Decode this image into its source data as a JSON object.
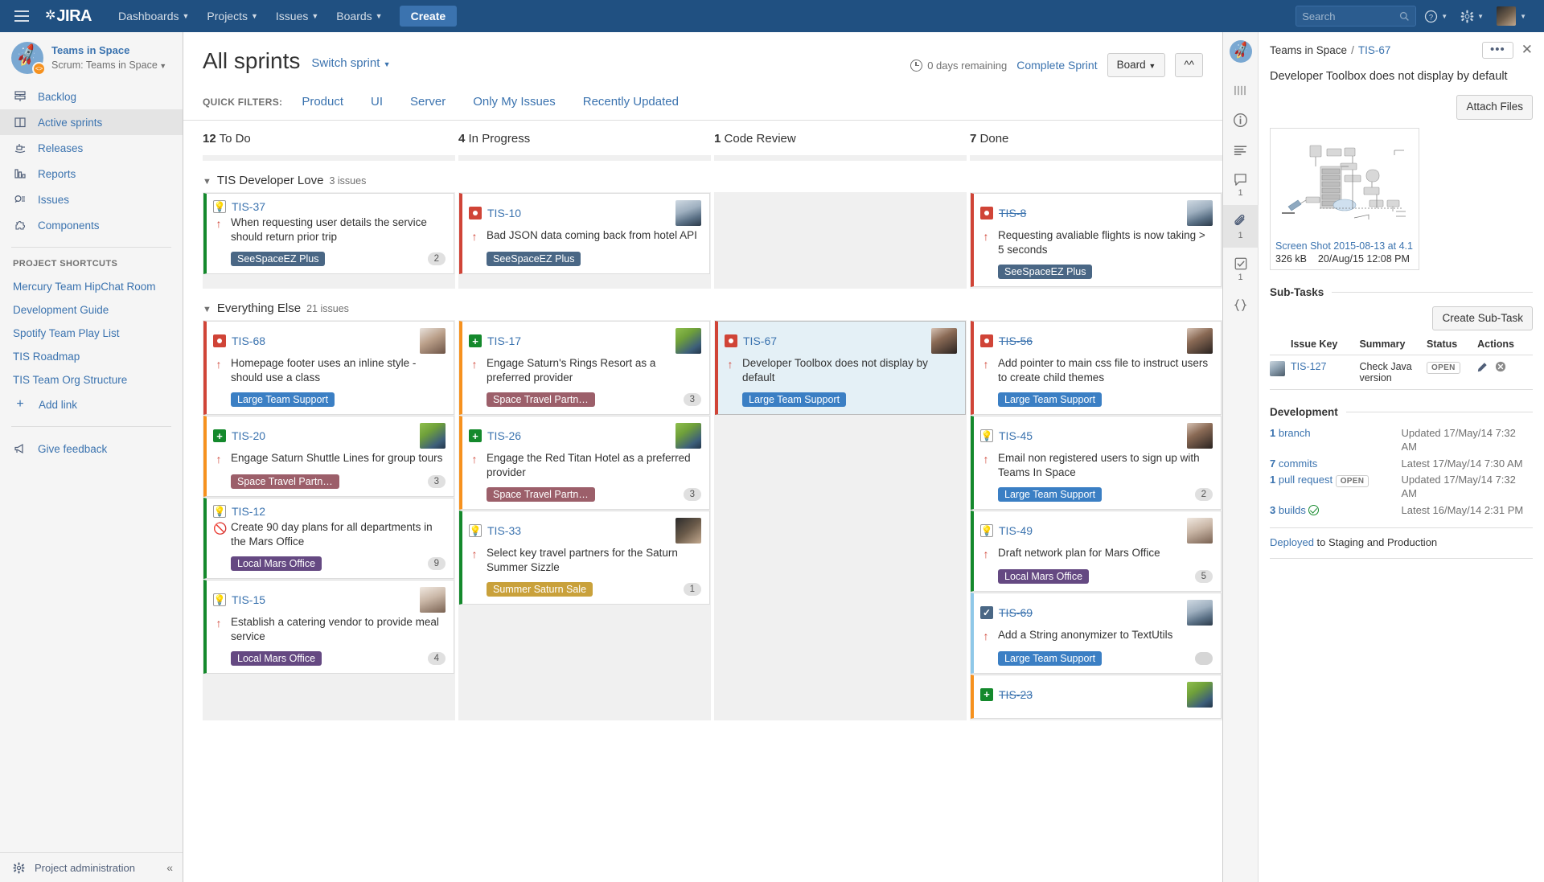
{
  "topnav": {
    "logo_text": "JIRA",
    "menus": [
      {
        "label": "Dashboards"
      },
      {
        "label": "Projects"
      },
      {
        "label": "Issues"
      },
      {
        "label": "Boards"
      }
    ],
    "create_label": "Create",
    "search_placeholder": "Search",
    "help_icon": "question-circle-icon",
    "settings_icon": "gear-icon",
    "profile_icon": "user-avatar"
  },
  "sidebar": {
    "project_name": "Teams in Space",
    "project_type": "Scrum: Teams in Space",
    "items": [
      {
        "label": "Backlog",
        "icon": "backlog-icon",
        "active": false
      },
      {
        "label": "Active sprints",
        "icon": "board-columns-icon",
        "active": true
      },
      {
        "label": "Releases",
        "icon": "releases-icon",
        "active": false
      },
      {
        "label": "Reports",
        "icon": "reports-bar-icon",
        "active": false
      },
      {
        "label": "Issues",
        "icon": "issues-search-icon",
        "active": false
      },
      {
        "label": "Components",
        "icon": "components-puzzle-icon",
        "active": false
      }
    ],
    "shortcuts_title": "PROJECT SHORTCUTS",
    "shortcuts": [
      {
        "label": "Mercury Team HipChat Room"
      },
      {
        "label": "Development Guide"
      },
      {
        "label": "Spotify Team Play List"
      },
      {
        "label": "TIS Roadmap"
      },
      {
        "label": "TIS Team Org Structure"
      }
    ],
    "add_link_label": "Add link",
    "feedback_label": "Give feedback",
    "admin_label": "Project administration",
    "collapse_icon": "chevron-double-left-icon"
  },
  "board": {
    "title": "All sprints",
    "switch_sprint": "Switch sprint",
    "days_remaining": "0 days remaining",
    "complete_sprint": "Complete Sprint",
    "board_button": "Board",
    "collapse_button_icon": "chevron-double-up-icon",
    "quick_filters_label": "QUICK FILTERS:",
    "quick_filters": [
      {
        "label": "Product"
      },
      {
        "label": "UI"
      },
      {
        "label": "Server"
      },
      {
        "label": "Only My Issues"
      },
      {
        "label": "Recently Updated"
      }
    ],
    "columns": [
      {
        "count": "12",
        "name": "To Do"
      },
      {
        "count": "4",
        "name": "In Progress"
      },
      {
        "count": "1",
        "name": "Code Review"
      },
      {
        "count": "7",
        "name": "Done"
      }
    ],
    "swimlanes": [
      {
        "name": "TIS Developer Love",
        "count": "3 issues",
        "columns": [
          [
            {
              "key": "TIS-37",
              "type": "story",
              "type_icon": "story-lightbulb-icon",
              "summary": "When requesting user details the service should return prior trip",
              "priority_icon": "priority-up-icon",
              "epic": "SeeSpaceEZ Plus",
              "epic_color": "e-blue-dark",
              "points": "2",
              "avatar": null,
              "border": "#14892c",
              "done": false
            }
          ],
          [
            {
              "key": "TIS-10",
              "type": "bug",
              "type_icon": "bug-icon",
              "summary": "Bad JSON data coming back from hotel API",
              "priority_icon": "priority-up-icon",
              "epic": "SeeSpaceEZ Plus",
              "epic_color": "e-blue-dark",
              "points": null,
              "avatar": "f1",
              "border": "#d04437",
              "done": false
            }
          ],
          [],
          [
            {
              "key": "TIS-8",
              "type": "bug",
              "type_icon": "bug-icon",
              "summary": "Requesting avaliable flights is now taking > 5 seconds",
              "priority_icon": "priority-up-icon",
              "epic": "SeeSpaceEZ Plus",
              "epic_color": "e-blue-dark",
              "points": null,
              "avatar": "f1",
              "border": "#d04437",
              "done": true
            }
          ]
        ]
      },
      {
        "name": "Everything Else",
        "count": "21 issues",
        "columns": [
          [
            {
              "key": "TIS-68",
              "type": "bug",
              "type_icon": "bug-icon",
              "summary": "Homepage footer uses an inline style - should use a class",
              "priority_icon": "priority-up-icon",
              "epic": "Large Team Support",
              "epic_color": "e-blue",
              "points": null,
              "avatar": "f2",
              "border": "#d04437",
              "done": false
            },
            {
              "key": "TIS-20",
              "type": "feature",
              "type_icon": "new-feature-plus-icon",
              "summary": "Engage Saturn Shuttle Lines for group tours",
              "priority_icon": "priority-up-icon",
              "epic": "Space Travel Partn…",
              "epic_color": "e-mauve",
              "points": "3",
              "avatar": "f3",
              "border": "#f6911e",
              "done": false
            },
            {
              "key": "TIS-12",
              "type": "story",
              "type_icon": "story-lightbulb-icon",
              "summary": "Create 90 day plans for all departments in the Mars Office",
              "priority_icon": "blocker-icon",
              "epic": "Local Mars Office",
              "epic_color": "e-purple",
              "points": "9",
              "avatar": null,
              "border": "#14892c",
              "done": false
            },
            {
              "key": "TIS-15",
              "type": "story",
              "type_icon": "story-lightbulb-icon",
              "summary": "Establish a catering vendor to provide meal service",
              "priority_icon": "priority-up-icon",
              "epic": "Local Mars Office",
              "epic_color": "e-purple",
              "points": "4",
              "avatar": "f5",
              "border": "#14892c",
              "done": false
            }
          ],
          [
            {
              "key": "TIS-17",
              "type": "feature",
              "type_icon": "new-feature-plus-icon",
              "summary": "Engage Saturn's Rings Resort as a preferred provider",
              "priority_icon": "priority-up-icon",
              "epic": "Space Travel Partn…",
              "epic_color": "e-mauve",
              "points": "3",
              "avatar": "f3",
              "border": "#f6911e",
              "done": false
            },
            {
              "key": "TIS-26",
              "type": "feature",
              "type_icon": "new-feature-plus-icon",
              "summary": "Engage the Red Titan Hotel as a preferred provider",
              "priority_icon": "priority-up-icon",
              "epic": "Space Travel Partn…",
              "epic_color": "e-mauve",
              "points": "3",
              "avatar": "f3",
              "border": "#f6911e",
              "done": false
            },
            {
              "key": "TIS-33",
              "type": "story",
              "type_icon": "story-lightbulb-icon",
              "summary": "Select key travel partners for the Saturn Summer Sizzle",
              "priority_icon": "priority-up-icon",
              "epic": "Summer Saturn Sale",
              "epic_color": "e-gold",
              "points": "1",
              "avatar": "f6",
              "border": "#14892c",
              "done": false
            }
          ],
          [
            {
              "key": "TIS-67",
              "type": "bug",
              "type_icon": "bug-icon",
              "summary": "Developer Toolbox does not display by default",
              "priority_icon": "priority-up-icon",
              "epic": "Large Team Support",
              "epic_color": "e-blue",
              "points": null,
              "avatar": "f4",
              "border": "#d04437",
              "done": false,
              "selected": true
            }
          ],
          [
            {
              "key": "TIS-56",
              "type": "bug",
              "type_icon": "bug-icon",
              "summary": "Add pointer to main css file to instruct users to create child themes",
              "priority_icon": "priority-up-icon",
              "epic": "Large Team Support",
              "epic_color": "e-blue",
              "points": null,
              "avatar": "f4",
              "border": "#d04437",
              "done": true
            },
            {
              "key": "TIS-45",
              "type": "story",
              "type_icon": "story-lightbulb-icon",
              "summary": "Email non registered users to sign up with Teams In Space",
              "priority_icon": "priority-up-icon",
              "epic": "Large Team Support",
              "epic_color": "e-blue",
              "points": "2",
              "avatar": "f4",
              "border": "#14892c",
              "done": false
            },
            {
              "key": "TIS-49",
              "type": "story",
              "type_icon": "story-lightbulb-icon",
              "summary": "Draft network plan for Mars Office",
              "priority_icon": "priority-up-icon",
              "epic": "Local Mars Office",
              "epic_color": "e-purple",
              "points": "5",
              "avatar": "f5",
              "border": "#14892c",
              "done": false
            },
            {
              "key": "TIS-69",
              "type": "task",
              "type_icon": "task-check-icon",
              "summary": "Add a String anonymizer to TextUtils",
              "priority_icon": "priority-up-icon",
              "epic": "Large Team Support",
              "epic_color": "e-blue",
              "points": "",
              "avatar": "f1",
              "border": "#8fc8e8",
              "done": true
            },
            {
              "key": "TIS-23",
              "type": "feature",
              "type_icon": "new-feature-plus-icon",
              "summary": "",
              "priority_icon": "",
              "epic": "",
              "epic_color": "e-mauve",
              "points": null,
              "avatar": "f3",
              "border": "#f6911e",
              "done": true
            }
          ]
        ]
      }
    ]
  },
  "detail": {
    "rail": [
      {
        "icon": "columns-bars-icon",
        "badge": null,
        "selected": false
      },
      {
        "icon": "info-circle-icon",
        "badge": null,
        "selected": false
      },
      {
        "icon": "description-lines-icon",
        "badge": null,
        "selected": false
      },
      {
        "icon": "comment-bubble-icon",
        "badge": "1",
        "selected": false
      },
      {
        "icon": "paperclip-icon",
        "badge": "1",
        "selected": true
      },
      {
        "icon": "subtask-check-icon",
        "badge": "1",
        "selected": false
      },
      {
        "icon": "code-braces-icon",
        "badge": null,
        "selected": false
      }
    ],
    "breadcrumb_project": "Teams in Space",
    "breadcrumb_sep": "/",
    "breadcrumb_key": "TIS-67",
    "more_actions": "•••",
    "close_icon": "close-x-icon",
    "summary": "Developer Toolbox does not display by default",
    "attach_files_label": "Attach Files",
    "attachment": {
      "name": "Screen Shot 2015-08-13 at 4.1",
      "size": "326 kB",
      "date": "20/Aug/15 12:08 PM"
    },
    "subtasks_title": "Sub-Tasks",
    "create_subtask_label": "Create Sub-Task",
    "subtasks_headers": [
      "Issue Key",
      "Summary",
      "Status",
      "Actions"
    ],
    "subtasks_rows": [
      {
        "avatar": "f7",
        "key": "TIS-127",
        "summary": "Check Java version",
        "status": "OPEN",
        "edit_icon": "pencil-icon",
        "delete_icon": "delete-circle-icon"
      }
    ],
    "development_title": "Development",
    "development_rows": [
      {
        "count": "1",
        "label": "branch",
        "lozenge": null,
        "check": false,
        "right": "Updated 17/May/14 7:32 AM"
      },
      {
        "count": "7",
        "label": "commits",
        "lozenge": null,
        "check": false,
        "right": "Latest 17/May/14 7:30 AM"
      },
      {
        "count": "1",
        "label": "pull request",
        "lozenge": "OPEN",
        "check": false,
        "right": "Updated 17/May/14 7:32 AM"
      },
      {
        "count": "3",
        "label": "builds",
        "lozenge": null,
        "check": true,
        "right": "Latest 16/May/14 2:31 PM"
      }
    ],
    "deployed_link": "Deployed",
    "deployed_rest": " to Staging and Production"
  }
}
